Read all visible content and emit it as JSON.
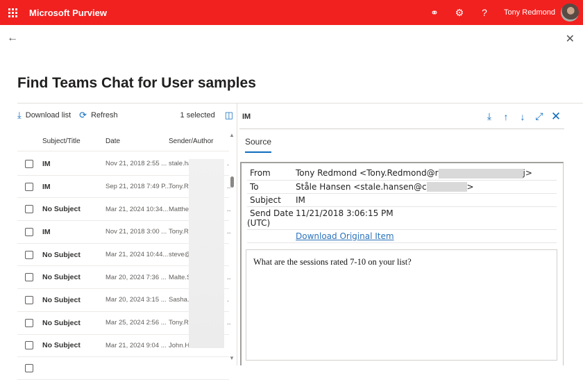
{
  "header": {
    "app_title": "Microsoft Purview",
    "user_name": "Tony Redmond",
    "icons": [
      "app-launcher-icon",
      "feedback-icon",
      "settings-icon",
      "help-icon"
    ]
  },
  "page": {
    "title": "Find Teams Chat for User samples",
    "back_icon": "←",
    "close_icon": "✕"
  },
  "list_toolbar": {
    "download_label": "Download list",
    "refresh_label": "Refresh",
    "selected_text": "1 selected"
  },
  "list": {
    "columns": [
      "Subject/Title",
      "Date",
      "Sender/Author"
    ],
    "rows": [
      {
        "subject": "IM",
        "date": "Nov 21, 2018 2:55 ...",
        "sender": "stale.ha",
        "ellipsis": "."
      },
      {
        "subject": "IM",
        "date": "Sep 21, 2018 7:49 P...",
        "sender": "Tony.R",
        "ellipsis": ".."
      },
      {
        "subject": "No Subject",
        "date": "Mar 21, 2024 10:34...",
        "sender": "Matthe",
        "ellipsis": ".."
      },
      {
        "subject": "IM",
        "date": "Nov 21, 2018 3:00 ...",
        "sender": "Tony.R",
        "ellipsis": ".."
      },
      {
        "subject": "No Subject",
        "date": "Mar 21, 2024 10:44...",
        "sender": "steve@",
        "ellipsis": ""
      },
      {
        "subject": "No Subject",
        "date": "Mar 20, 2024 7:36 ...",
        "sender": "Malte.S",
        "ellipsis": ".."
      },
      {
        "subject": "No Subject",
        "date": "Mar 20, 2024 3:15 ...",
        "sender": "Sasha.Y",
        "ellipsis": "."
      },
      {
        "subject": "No Subject",
        "date": "Mar 25, 2024 2:56 ...",
        "sender": "Tony.R",
        "ellipsis": ".."
      },
      {
        "subject": "No Subject",
        "date": "Mar 21, 2024 9:04 ...",
        "sender": "John.H",
        "ellipsis": ""
      }
    ]
  },
  "detail": {
    "title": "IM",
    "tab": "Source",
    "meta": {
      "from_label": "From",
      "from_value": "Tony Redmond <Tony.Redmond@r",
      "from_suffix": "j>",
      "to_label": "To",
      "to_value": "Ståle Hansen <stale.hansen@c",
      "to_suffix": ">",
      "subject_label": "Subject",
      "subject_value": "IM",
      "date_label_1": "Send Date",
      "date_label_2": "(UTC)",
      "date_value": "11/21/2018 3:06:15 PM",
      "download_link": "Download Original Item"
    },
    "body": "What are the sessions rated 7-10 on your list?"
  },
  "colors": {
    "brand_bar": "#f1211f",
    "accent": "#0f6cbd",
    "link": "#2b72b9"
  }
}
